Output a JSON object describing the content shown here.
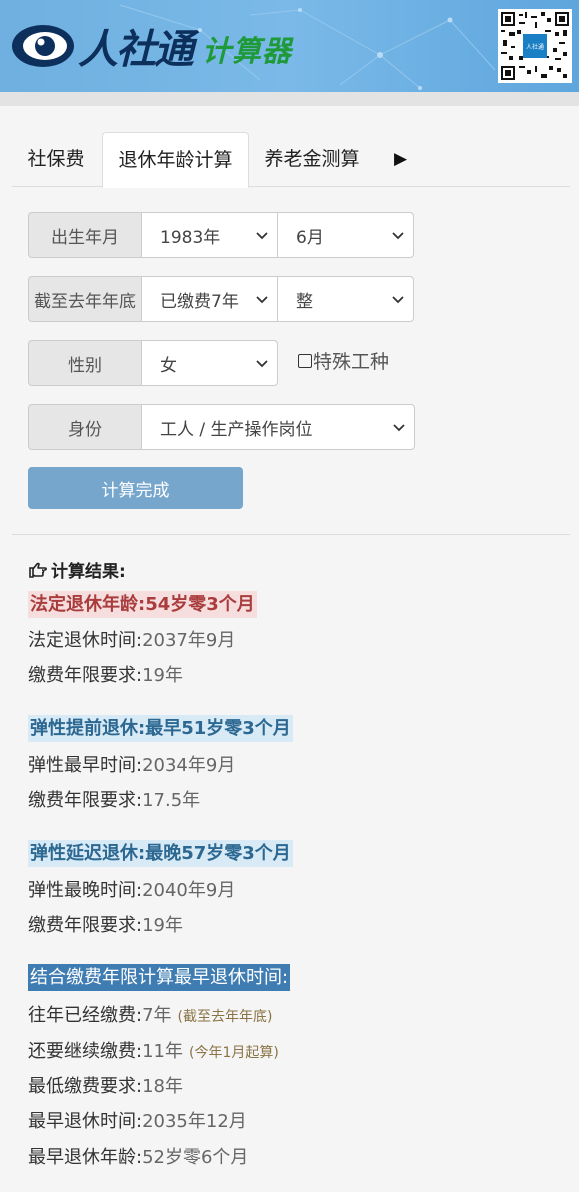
{
  "header": {
    "logo_text": "人社通",
    "logo_sub": "计算器",
    "qr_label": "人社通"
  },
  "tabs": [
    {
      "label": "社保费",
      "active": false
    },
    {
      "label": "退休年龄计算",
      "active": true
    },
    {
      "label": "养老金测算",
      "active": false
    }
  ],
  "tab_more": "▶",
  "form": {
    "birth_label": "出生年月",
    "birth_year": "1983年",
    "birth_month": "6月",
    "paid_label": "截至去年年底",
    "paid_years": "已缴费7年",
    "paid_months": "整",
    "gender_label": "性别",
    "gender": "女",
    "special_label": "特殊工种",
    "identity_label": "身份",
    "identity": "工人 / 生产操作岗位",
    "submit": "计算完成"
  },
  "result": {
    "title": "计算结果:",
    "legal": {
      "head": "法定退休年龄:54岁零3个月",
      "time_label": "法定退休时间:",
      "time": "2037年9月",
      "years_label": "缴费年限要求:",
      "years": "19年"
    },
    "early": {
      "head": "弹性提前退休:最早51岁零3个月",
      "time_label": "弹性最早时间:",
      "time": "2034年9月",
      "years_label": "缴费年限要求:",
      "years": "17.5年"
    },
    "late": {
      "head": "弹性延迟退休:最晚57岁零3个月",
      "time_label": "弹性最晚时间:",
      "time": "2040年9月",
      "years_label": "缴费年限要求:",
      "years": "19年"
    },
    "combined": {
      "head": "结合缴费年限计算最早退休时间:",
      "paid_label": "往年已经缴费:",
      "paid": "7年",
      "paid_note": "(截至去年年底)",
      "remain_label": "还要继续缴费:",
      "remain": "11年",
      "remain_note": "(今年1月起算)",
      "min_label": "最低缴费要求:",
      "min": "18年",
      "earliest_time_label": "最早退休时间:",
      "earliest_time": "2035年12月",
      "earliest_age_label": "最早退休年龄:",
      "earliest_age": "52岁零6个月"
    }
  },
  "colors": {
    "header_bg": "#6fb0e0",
    "button": "#77a6cd",
    "red_text": "#a93d3d",
    "blue_text": "#2c6891",
    "dark_highlight": "#3f7cb1"
  }
}
